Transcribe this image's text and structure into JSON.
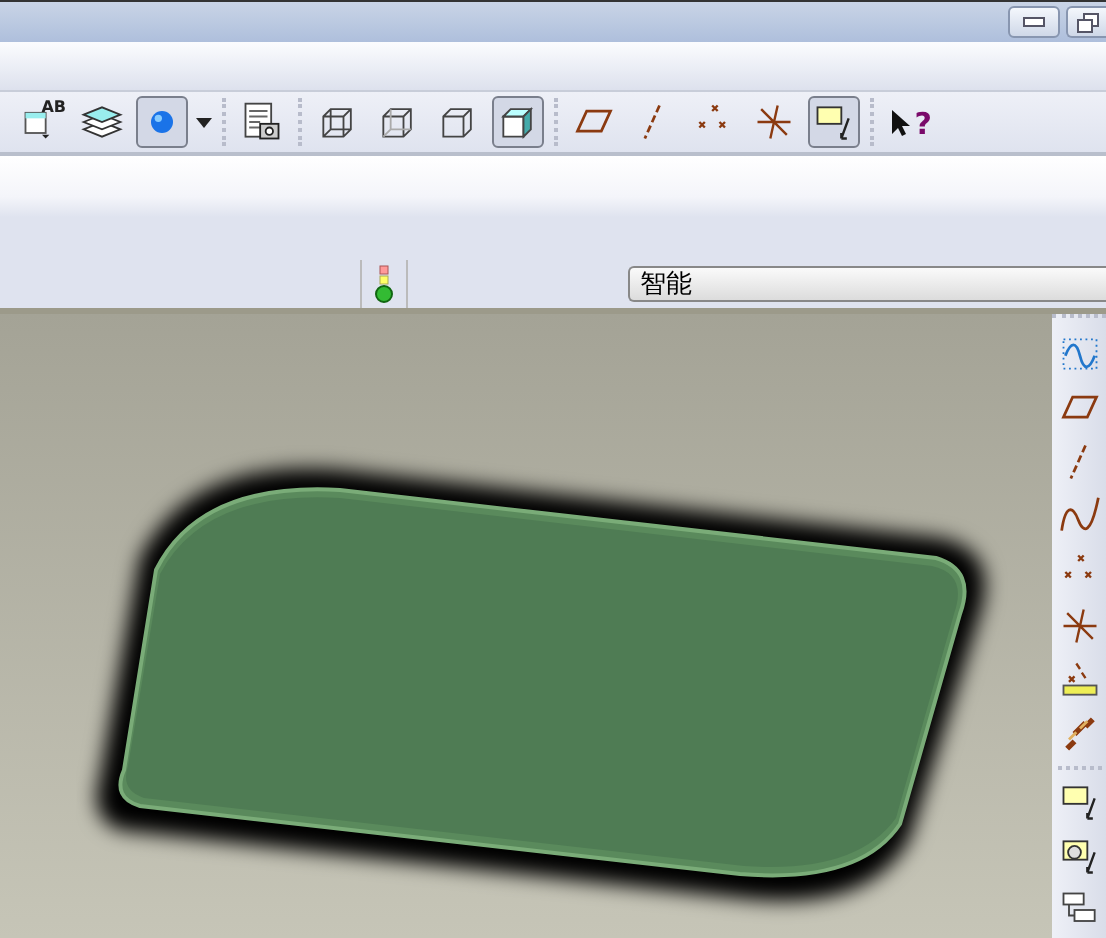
{
  "toolbar": [
    {
      "kind": "text-style",
      "text": "AB",
      "selected": false
    },
    {
      "kind": "layers",
      "selected": false
    },
    {
      "kind": "sphere",
      "selected": true,
      "caret": true
    },
    {
      "kind": "sep"
    },
    {
      "kind": "table-camera",
      "selected": false
    },
    {
      "kind": "sep"
    },
    {
      "kind": "wireframe",
      "selected": false
    },
    {
      "kind": "hidden",
      "selected": false
    },
    {
      "kind": "nohidden",
      "selected": false
    },
    {
      "kind": "shaded",
      "selected": true
    },
    {
      "kind": "sep"
    },
    {
      "kind": "plane",
      "selected": false
    },
    {
      "kind": "axis",
      "selected": false
    },
    {
      "kind": "points",
      "selected": false
    },
    {
      "kind": "csys",
      "selected": false
    },
    {
      "kind": "note",
      "selected": true
    },
    {
      "kind": "sep"
    },
    {
      "kind": "help",
      "text": "?",
      "selected": false
    }
  ],
  "status": {
    "mode": "智能"
  },
  "side_toolbar": [
    {
      "kind": "sketch",
      "selected": false
    },
    {
      "kind": "plane",
      "selected": false
    },
    {
      "kind": "axis",
      "selected": false
    },
    {
      "kind": "curve",
      "selected": false
    },
    {
      "kind": "points",
      "selected": false
    },
    {
      "kind": "csys",
      "selected": false
    },
    {
      "kind": "analysis",
      "selected": false
    },
    {
      "kind": "chain",
      "selected": false
    },
    {
      "kind": "sep"
    },
    {
      "kind": "note",
      "selected": false
    },
    {
      "kind": "note2",
      "selected": false
    },
    {
      "kind": "boxes",
      "selected": false
    }
  ]
}
